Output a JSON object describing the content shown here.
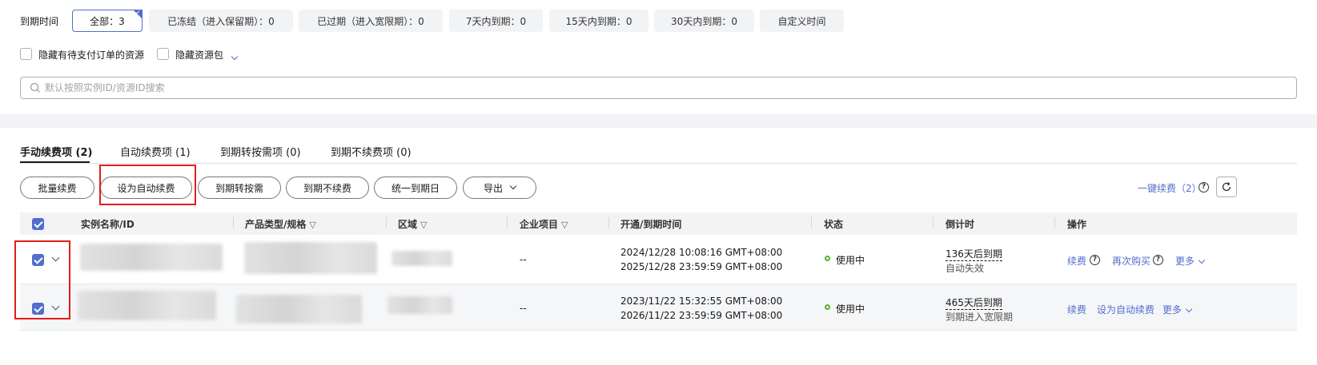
{
  "filter": {
    "label": "到期时间",
    "options": [
      {
        "label": "全部：3",
        "active": true
      },
      {
        "label": "已冻结（进入保留期）：0",
        "active": false
      },
      {
        "label": "已过期（进入宽限期）：0",
        "active": false
      },
      {
        "label": "7天内到期：0",
        "active": false
      },
      {
        "label": "15天内到期：0",
        "active": false
      },
      {
        "label": "30天内到期：0",
        "active": false
      },
      {
        "label": "自定义时间",
        "active": false
      }
    ],
    "hide_pending_label": "隐藏有待支付订单的资源",
    "hide_package_label": "隐藏资源包"
  },
  "search": {
    "placeholder": "默认按照实例ID/资源ID搜索"
  },
  "tabs": [
    {
      "label": "手动续费项 (2)",
      "active": true
    },
    {
      "label": "自动续费项 (1)",
      "active": false
    },
    {
      "label": "到期转按需项 (0)",
      "active": false
    },
    {
      "label": "到期不续费项 (0)",
      "active": false
    }
  ],
  "actions": {
    "batch_renew": "批量续费",
    "set_auto_renew": "设为自动续费",
    "to_on_demand": "到期转按需",
    "no_renew": "到期不续费",
    "unify_date": "统一到期日",
    "export": "导出",
    "one_click_renew": "一键续费（2）"
  },
  "table": {
    "headers": {
      "name": "实例名称/ID",
      "product": "产品类型/规格",
      "region": "区域",
      "project": "企业项目",
      "time": "开通/到期时间",
      "status": "状态",
      "countdown": "倒计时",
      "ops": "操作"
    },
    "rows": [
      {
        "checked": true,
        "project": "--",
        "open_time": "2024/12/28 10:08:16 GMT+08:00",
        "expire_time": "2025/12/28 23:59:59 GMT+08:00",
        "status": "使用中",
        "countdown": "136天后到期",
        "countdown_note": "自动失效",
        "op1": "续费",
        "op2": "再次购买",
        "more": "更多"
      },
      {
        "checked": true,
        "project": "--",
        "open_time": "2023/11/22 15:32:55 GMT+08:00",
        "expire_time": "2026/11/22 23:59:59 GMT+08:00",
        "status": "使用中",
        "countdown": "465天后到期",
        "countdown_note": "到期进入宽限期",
        "op1": "续费",
        "op2": "设为自动续费",
        "more": "更多"
      }
    ]
  },
  "colors": {
    "accent": "#526ecc",
    "highlight": "#e31c1c",
    "status_ok": "#50b432"
  }
}
